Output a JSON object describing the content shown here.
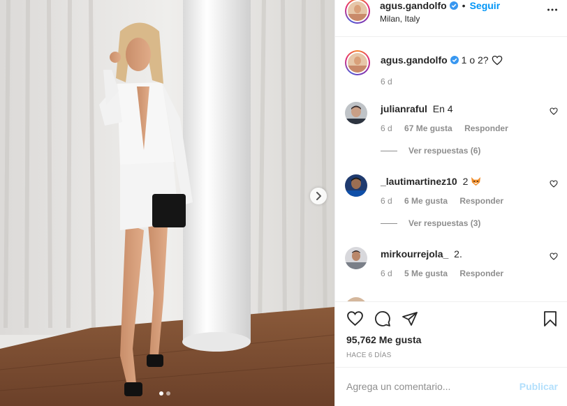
{
  "header": {
    "username": "agus.gandolfo",
    "separator": "•",
    "follow_label": "Seguir",
    "location": "Milan, Italy"
  },
  "caption": {
    "username": "agus.gandolfo",
    "text": "1 o 2?",
    "time": "6 d"
  },
  "comments": [
    {
      "username": "julianraful",
      "text": "En 4",
      "time": "6 d",
      "likes": "67 Me gusta",
      "reply": "Responder",
      "view_replies": "Ver respuestas (6)"
    },
    {
      "username": "_lautimartinez10",
      "text": "2",
      "time": "6 d",
      "likes": "6 Me gusta",
      "reply": "Responder",
      "view_replies": "Ver respuestas (3)"
    },
    {
      "username": "mirkourrejola_",
      "text": "2.",
      "time": "6 d",
      "likes": "5 Me gusta",
      "reply": "Responder"
    }
  ],
  "stats": {
    "likes": "95,762 Me gusta",
    "posted": "HACE 6 DÍAS"
  },
  "add_comment": {
    "placeholder": "Agrega un comentario...",
    "publish_label": "Publicar"
  },
  "carousel": {
    "slides": 2,
    "active_index": 0
  },
  "icons": [
    "chevron-right-icon",
    "verified-badge-icon",
    "more-options-icon",
    "heart-icon",
    "comment-icon",
    "share-icon",
    "bookmark-icon",
    "fox-emoji-icon"
  ],
  "colors": {
    "link_blue": "#0095f6",
    "publish_disabled": "#b2dffc",
    "muted_text": "#8e8e8e",
    "text": "#262626",
    "verified": "#3897f0"
  }
}
